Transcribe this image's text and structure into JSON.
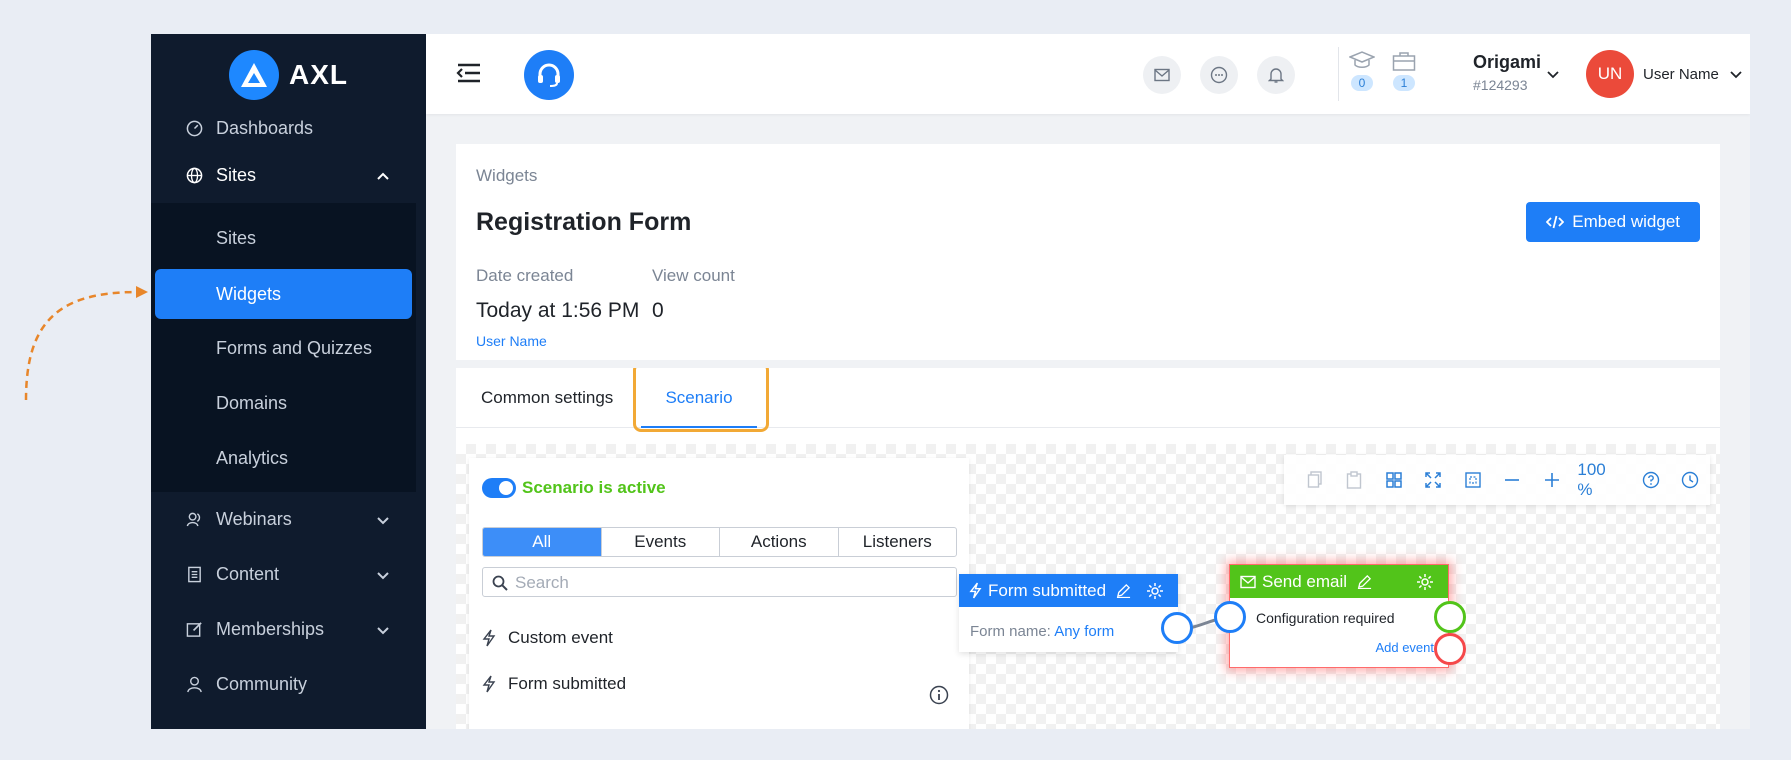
{
  "brand": {
    "name": "AXL",
    "accent": "#1e7ef7"
  },
  "sidebar": {
    "items": [
      {
        "label": "Dashboards",
        "icon": "dashboard-icon"
      },
      {
        "label": "Sites",
        "icon": "globe-icon"
      },
      {
        "label": "Webinars",
        "icon": "webinar-icon"
      },
      {
        "label": "Content",
        "icon": "content-icon"
      },
      {
        "label": "Memberships",
        "icon": "edit-icon"
      },
      {
        "label": "Community",
        "icon": "user-icon"
      }
    ],
    "sites_sub": [
      {
        "label": "Sites"
      },
      {
        "label": "Widgets"
      },
      {
        "label": "Forms and Quizzes"
      },
      {
        "label": "Domains"
      },
      {
        "label": "Analytics"
      }
    ]
  },
  "header": {
    "courses_count": "0",
    "orders_count": "1",
    "org_name": "Origami",
    "org_id": "#124293",
    "avatar_initials": "UN",
    "user_name": "User Name"
  },
  "page": {
    "breadcrumb": "Widgets",
    "title": "Registration Form",
    "embed_label": "Embed widget",
    "date_created_label": "Date created",
    "date_created_value": "Today at 1:56 PM",
    "view_count_label": "View count",
    "view_count_value": "0",
    "author": "User Name"
  },
  "tabs": [
    {
      "label": "Common settings"
    },
    {
      "label": "Scenario"
    }
  ],
  "scenario": {
    "active_label": "Scenario is active",
    "filters": [
      "All",
      "Events",
      "Actions",
      "Listeners"
    ],
    "search_placeholder": "Search",
    "palette_items": [
      "Custom event",
      "Form submitted"
    ],
    "zoom": "100 %",
    "nodes": {
      "form_submitted": {
        "title": "Form submitted",
        "field_label": "Form name:",
        "field_value": "Any form",
        "color": "#1e7ef7"
      },
      "send_email": {
        "title": "Send email",
        "status": "Configuration required",
        "add_event": "Add event",
        "color": "#52c41a"
      }
    }
  }
}
